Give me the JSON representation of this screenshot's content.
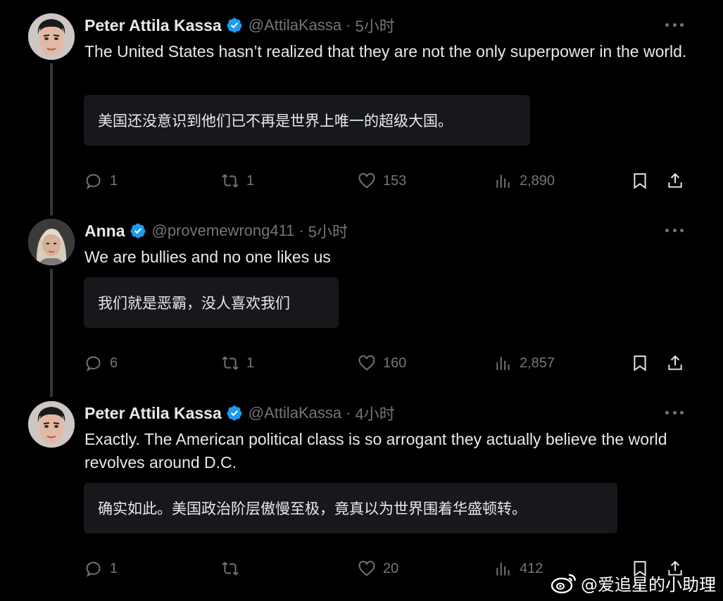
{
  "colors": {
    "background": "#000000",
    "text_primary": "#e7e9ea",
    "text_secondary": "#71767b",
    "verified_blue": "#1d9bf0",
    "translation_bg": "#16181c",
    "thread_line": "#333639"
  },
  "icons": {
    "reply": "reply-icon",
    "retweet": "retweet-icon",
    "like": "heart-icon",
    "views": "views-icon",
    "bookmark": "bookmark-icon",
    "share": "share-icon",
    "verified": "verified-badge-icon",
    "more": "more-icon"
  },
  "tweets": [
    {
      "name": "Peter Attila Kassa",
      "handle": "@AttilaKassa",
      "separator": "·",
      "time": "5小时",
      "text": "The United States hasn’t realized that they are not the only superpower in the world.",
      "translation": "美国还没意识到他们已不再是世界上唯一的超级大国。",
      "replies": "1",
      "retweets": "1",
      "likes": "153",
      "views": "2,890"
    },
    {
      "name": "Anna",
      "handle": "@provemewrong411",
      "separator": "·",
      "time": "5小时",
      "text": "We are bullies and no one likes us",
      "translation": "我们就是恶霸，没人喜欢我们",
      "replies": "6",
      "retweets": "1",
      "likes": "160",
      "views": "2,857"
    },
    {
      "name": "Peter Attila Kassa",
      "handle": "@AttilaKassa",
      "separator": "·",
      "time": "4小时",
      "text": "Exactly. The American political class is so arrogant they actually believe the world revolves around D.C.",
      "translation": "确实如此。美国政治阶层傲慢至极，竟真以为世界围着华盛顿转。",
      "replies": "1",
      "retweets": "",
      "likes": "20",
      "views": "412"
    }
  ],
  "watermark": {
    "text": "@爱追星的小助理",
    "icon": "weibo-logo-icon"
  }
}
